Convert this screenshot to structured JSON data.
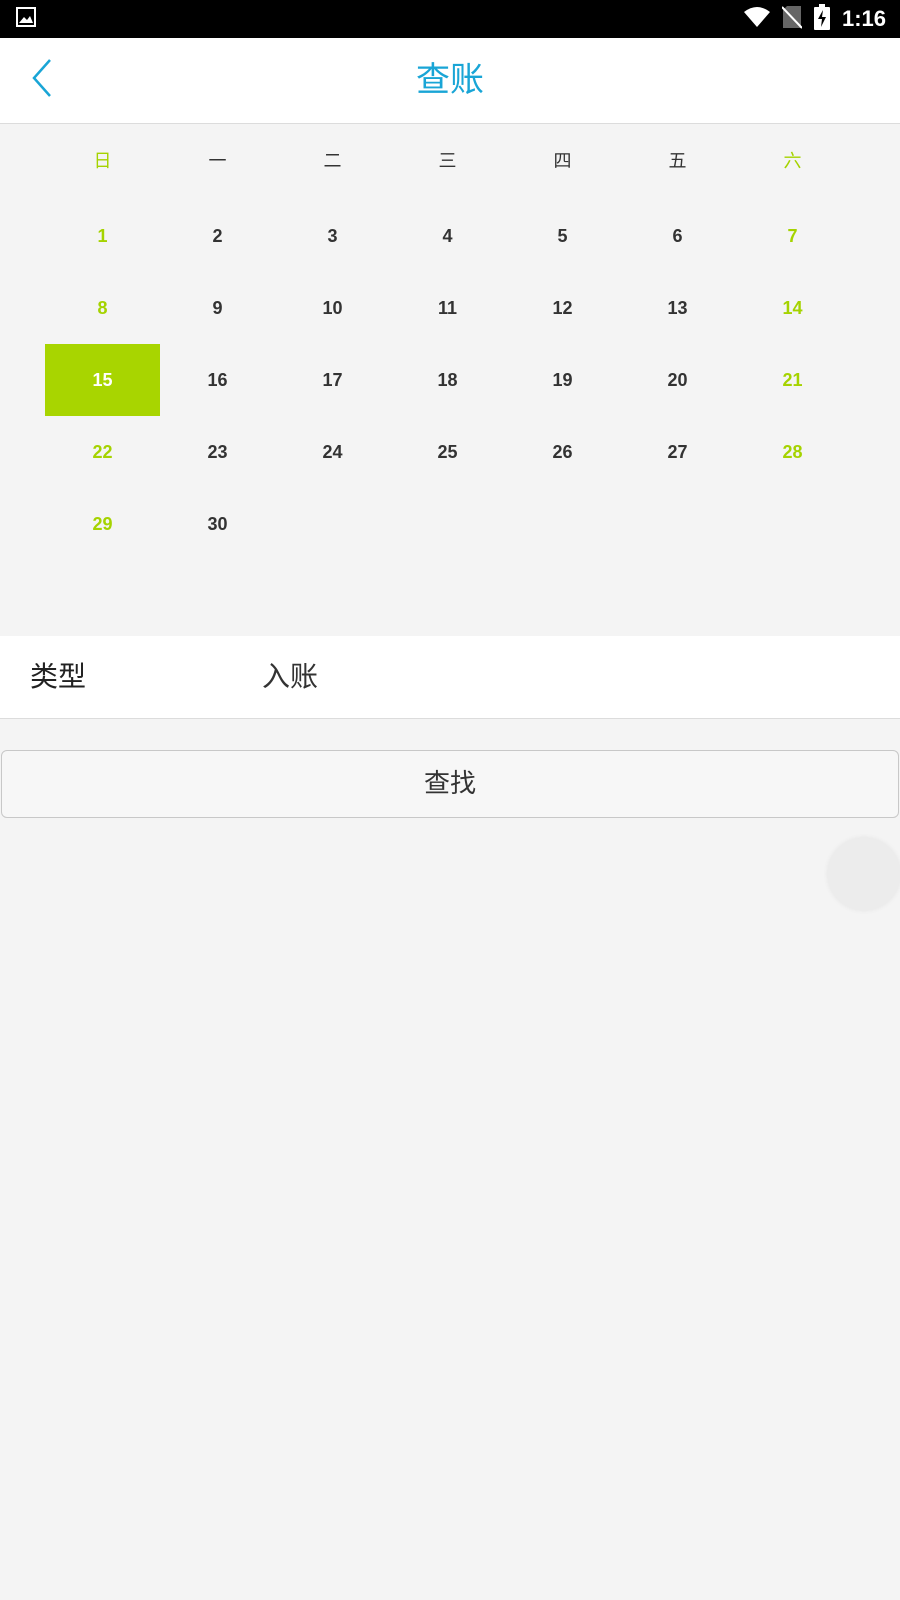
{
  "status_bar": {
    "time": "1:16",
    "icons": [
      "image-icon",
      "wifi-icon",
      "no-sim-icon",
      "battery-charging-icon"
    ]
  },
  "app_bar": {
    "title": "查账",
    "back_icon": "chevron-left-icon",
    "accent_color": "#19a5d6"
  },
  "calendar": {
    "weekdays": [
      "日",
      "一",
      "二",
      "三",
      "四",
      "五",
      "六"
    ],
    "days": [
      "1",
      "2",
      "3",
      "4",
      "5",
      "6",
      "7",
      "8",
      "9",
      "10",
      "11",
      "12",
      "13",
      "14",
      "15",
      "16",
      "17",
      "18",
      "19",
      "20",
      "21",
      "22",
      "23",
      "24",
      "25",
      "26",
      "27",
      "28",
      "29",
      "30"
    ],
    "first_weekday_index": 0,
    "selected_day": "15",
    "weekend_color": "#a5d300",
    "selected_color": "#a8d500"
  },
  "type_row": {
    "label": "类型",
    "value": "入账"
  },
  "search_button": {
    "label": "查找"
  }
}
